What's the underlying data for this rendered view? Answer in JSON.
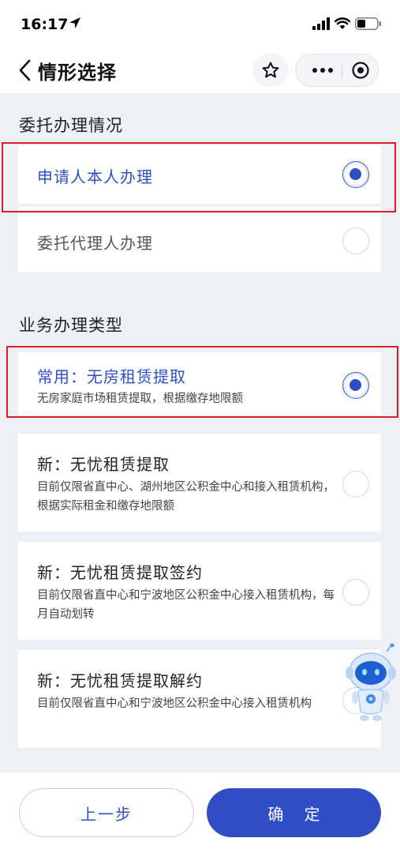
{
  "status_bar": {
    "time": "16:17"
  },
  "nav": {
    "title": "情形选择"
  },
  "section1": {
    "title": "委托办理情况",
    "options": [
      {
        "label": "申请人本人办理",
        "selected": true
      },
      {
        "label": "委托代理人办理",
        "selected": false
      }
    ]
  },
  "section2": {
    "title": "业务办理类型",
    "options": [
      {
        "label": "常用：无房租赁提取",
        "desc": "无房家庭市场租赁提取，根据缴存地限额",
        "selected": true
      },
      {
        "label": "新：无忧租赁提取",
        "desc": "目前仅限省直中心、湖州地区公积金中心和接入租赁机构，根据实际租金和缴存地限额",
        "selected": false
      },
      {
        "label": "新：无忧租赁提取签约",
        "desc": "目前仅限省直中心和宁波地区公积金中心接入租赁机构，每月自动划转",
        "selected": false
      },
      {
        "label": "新：无忧租赁提取解约",
        "desc": "目前仅限省直中心和宁波地区公积金中心接入租赁机构",
        "selected": false
      }
    ]
  },
  "buttons": {
    "prev": "上一步",
    "confirm": "确 定"
  },
  "colors": {
    "primary": "#2f4ec6",
    "highlight": "#d8202a",
    "background": "#eef0f5"
  },
  "icons": [
    "location-arrow-icon",
    "signal-icon",
    "wifi-icon",
    "battery-icon",
    "back-chevron-icon",
    "star-icon",
    "more-dots-icon",
    "close-target-icon",
    "assistant-robot-icon"
  ]
}
